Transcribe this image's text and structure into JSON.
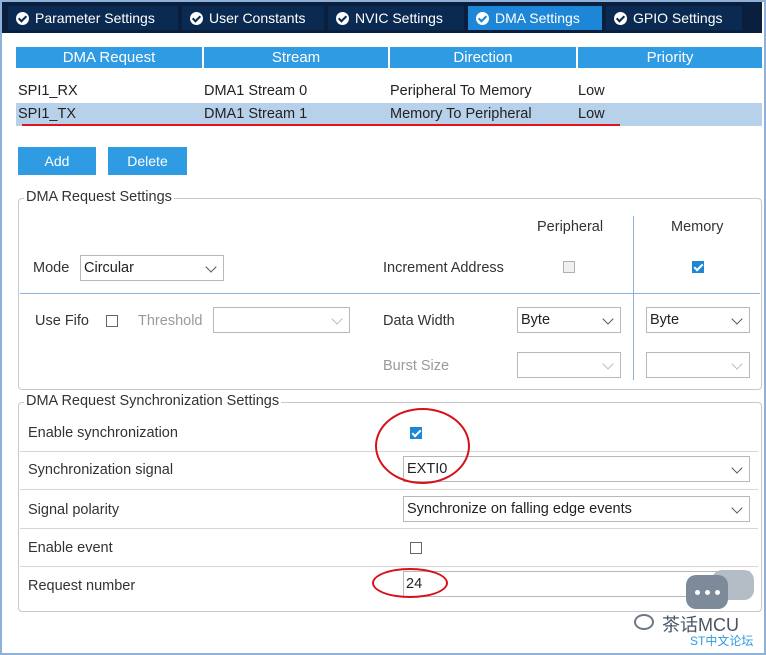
{
  "tabs": [
    {
      "label": "Parameter Settings",
      "active": false
    },
    {
      "label": "User Constants",
      "active": false
    },
    {
      "label": "NVIC Settings",
      "active": false
    },
    {
      "label": "DMA Settings",
      "active": true
    },
    {
      "label": "GPIO Settings",
      "active": false
    }
  ],
  "table": {
    "headers": [
      "DMA Request",
      "Stream",
      "Direction",
      "Priority"
    ],
    "rows": [
      {
        "request": "SPI1_RX",
        "stream": "DMA1 Stream 0",
        "direction": "Peripheral To Memory",
        "priority": "Low"
      },
      {
        "request": "SPI1_TX",
        "stream": "DMA1 Stream 1",
        "direction": "Memory To Peripheral",
        "priority": "Low",
        "selected": true
      }
    ]
  },
  "buttons": {
    "add": "Add",
    "delete": "Delete"
  },
  "request_settings": {
    "title": "DMA Request Settings",
    "peripheral_header": "Peripheral",
    "memory_header": "Memory",
    "mode_label": "Mode",
    "mode_value": "Circular",
    "increment_label": "Increment Address",
    "increment_peripheral": false,
    "increment_memory": true,
    "use_fifo_label": "Use Fifo",
    "use_fifo": false,
    "threshold_label": "Threshold",
    "threshold_value": "",
    "data_width_label": "Data Width",
    "data_width_peripheral": "Byte",
    "data_width_memory": "Byte",
    "burst_size_label": "Burst Size",
    "burst_peripheral": "",
    "burst_memory": ""
  },
  "sync_settings": {
    "title": "DMA Request Synchronization Settings",
    "enable_sync_label": "Enable synchronization",
    "enable_sync": true,
    "sync_signal_label": "Synchronization signal",
    "sync_signal_value": "EXTI0",
    "polarity_label": "Signal polarity",
    "polarity_value": "Synchronize on falling edge events",
    "enable_event_label": "Enable event",
    "enable_event": false,
    "request_number_label": "Request number",
    "request_number_value": "24"
  },
  "watermark": {
    "title": "茶话MCU",
    "subtitle": "ST中文论坛"
  },
  "colors": {
    "tab_active": "#1e86d6",
    "header": "#2e9be3",
    "selected_row": "#b8d1ea",
    "annotation_red": "#d8101a"
  }
}
